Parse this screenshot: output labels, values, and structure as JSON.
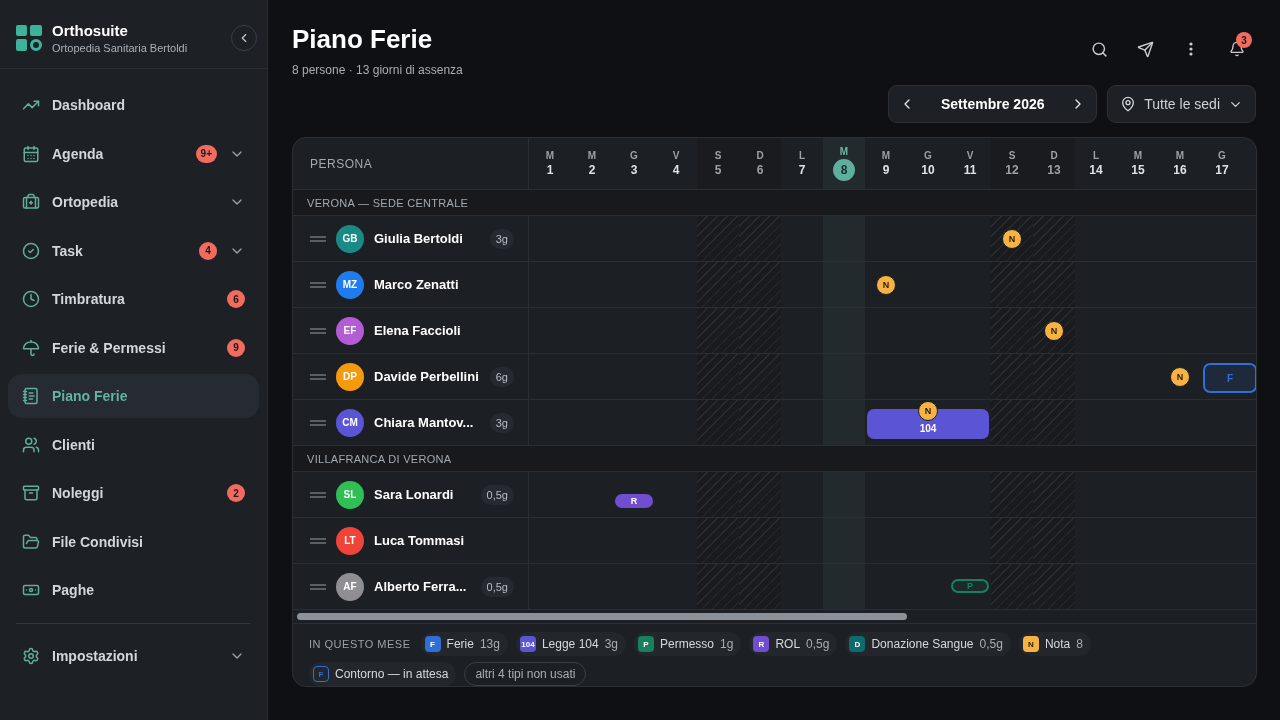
{
  "app": {
    "name": "Orthosuite",
    "subtitle": "Ortopedia Sanitaria Bertoldi"
  },
  "sidebar": {
    "items": [
      {
        "label": "Dashboard",
        "selected": false,
        "expandable": false
      },
      {
        "label": "Agenda",
        "badge": "9+",
        "selected": false,
        "expandable": true
      },
      {
        "label": "Ortopedia",
        "selected": false,
        "expandable": true
      },
      {
        "label": "Task",
        "badge": "4",
        "selected": false,
        "expandable": true
      },
      {
        "label": "Timbratura",
        "badge": "6",
        "selected": false,
        "expandable": false
      },
      {
        "label": "Ferie & Permessi",
        "badge": "9",
        "selected": false,
        "expandable": false
      },
      {
        "label": "Piano Ferie",
        "selected": true,
        "expandable": false
      },
      {
        "label": "Clienti",
        "selected": false,
        "expandable": false
      },
      {
        "label": "Noleggi",
        "badge": "2",
        "selected": false,
        "expandable": false
      },
      {
        "label": "File Condivisi",
        "selected": false,
        "expandable": false
      },
      {
        "label": "Paghe",
        "selected": false,
        "expandable": false
      }
    ],
    "footer_items": [
      {
        "label": "Impostazioni",
        "selected": false,
        "expandable": true
      }
    ]
  },
  "page": {
    "title": "Piano Ferie",
    "subtitle": "8 persone · 13 giorni di assenza",
    "notifications": "3"
  },
  "month": "Settembre 2026",
  "location_filter": "Tutte le sedi",
  "table": {
    "person_header": "PERSONA",
    "days": [
      {
        "weekday": "M",
        "day": "1",
        "weekend": false,
        "today": false
      },
      {
        "weekday": "M",
        "day": "2",
        "weekend": false,
        "today": false
      },
      {
        "weekday": "G",
        "day": "3",
        "weekend": false,
        "today": false
      },
      {
        "weekday": "V",
        "day": "4",
        "weekend": false,
        "today": false
      },
      {
        "weekday": "S",
        "day": "5",
        "weekend": true,
        "today": false
      },
      {
        "weekday": "D",
        "day": "6",
        "weekend": true,
        "today": false
      },
      {
        "weekday": "L",
        "day": "7",
        "weekend": false,
        "today": false
      },
      {
        "weekday": "M",
        "day": "8",
        "weekend": false,
        "today": true
      },
      {
        "weekday": "M",
        "day": "9",
        "weekend": false,
        "today": false
      },
      {
        "weekday": "G",
        "day": "10",
        "weekend": false,
        "today": false
      },
      {
        "weekday": "V",
        "day": "11",
        "weekend": false,
        "today": false
      },
      {
        "weekday": "S",
        "day": "12",
        "weekend": true,
        "today": false
      },
      {
        "weekday": "D",
        "day": "13",
        "weekend": true,
        "today": false
      },
      {
        "weekday": "L",
        "day": "14",
        "weekend": false,
        "today": false
      },
      {
        "weekday": "M",
        "day": "15",
        "weekend": false,
        "today": false
      },
      {
        "weekday": "M",
        "day": "16",
        "weekend": false,
        "today": false
      },
      {
        "weekday": "G",
        "day": "17",
        "weekend": false,
        "today": false
      }
    ],
    "groups": [
      {
        "name": "VERONA — SEDE CENTRALE",
        "people": [
          {
            "initials": "GB",
            "name": "Giulia Bertoldi",
            "color": "#1a8a86",
            "total": "3g",
            "events": [
              {
                "kind": "note",
                "label": "N"
              }
            ]
          },
          {
            "initials": "MZ",
            "name": "Marco Zenatti",
            "color": "#1f7cf0",
            "events": [
              {
                "kind": "note",
                "label": "N"
              }
            ]
          },
          {
            "initials": "EF",
            "name": "Elena Faccioli",
            "color": "#b45bd6",
            "events": [
              {
                "kind": "note",
                "label": "N"
              }
            ]
          },
          {
            "initials": "DP",
            "name": "Davide Perbellini",
            "color": "#f59a0c",
            "total": "6g",
            "events": [
              {
                "kind": "note",
                "label": "N"
              },
              {
                "kind": "ferie",
                "pending": true,
                "label": "F"
              }
            ]
          },
          {
            "initials": "CM",
            "name": "Chiara Mantov...",
            "color": "#5b55d6",
            "total": "3g",
            "events": [
              {
                "kind": "note",
                "label": "N"
              },
              {
                "kind": "legge104",
                "pending": false,
                "label": "104"
              }
            ]
          }
        ]
      },
      {
        "name": "VILLAFRANCA DI VERONA",
        "people": [
          {
            "initials": "SL",
            "name": "Sara Lonardi",
            "color": "#2fbf55",
            "total": "0,5g",
            "events": [
              {
                "kind": "rol",
                "pending": false,
                "label": "R"
              }
            ]
          },
          {
            "initials": "LT",
            "name": "Luca Tommasi",
            "color": "#f0433a"
          },
          {
            "initials": "AF",
            "name": "Alberto Ferra...",
            "color": "#8e8e93",
            "total": "0,5g",
            "events": [
              {
                "kind": "permesso",
                "pending": true,
                "label": "P"
              }
            ]
          }
        ]
      }
    ]
  },
  "legend": {
    "title": "IN QUESTO MESE",
    "items": [
      {
        "code": "F",
        "label": "Ferie",
        "count": "13g",
        "color": "#2f6fd6",
        "outlined": false
      },
      {
        "code": "104",
        "label": "Legge 104",
        "count": "3g",
        "color": "#5b55d6",
        "outlined": false
      },
      {
        "code": "P",
        "label": "Permesso",
        "count": "1g",
        "color": "#17805e",
        "outlined": false
      },
      {
        "code": "R",
        "label": "ROL",
        "count": "0,5g",
        "color": "#6f4fd0",
        "outlined": false
      },
      {
        "code": "D",
        "label": "Donazione Sangue",
        "count": "0,5g",
        "color": "#0f6b6b",
        "outlined": false
      },
      {
        "code": "N",
        "label": "Nota",
        "count": "8",
        "color": "#f6b343",
        "outlined": false
      },
      {
        "code": "F",
        "label": "Contorno — in attesa",
        "color": "#2f6fd6",
        "outlined": true
      }
    ],
    "more": "altri 4 tipi non usati"
  }
}
